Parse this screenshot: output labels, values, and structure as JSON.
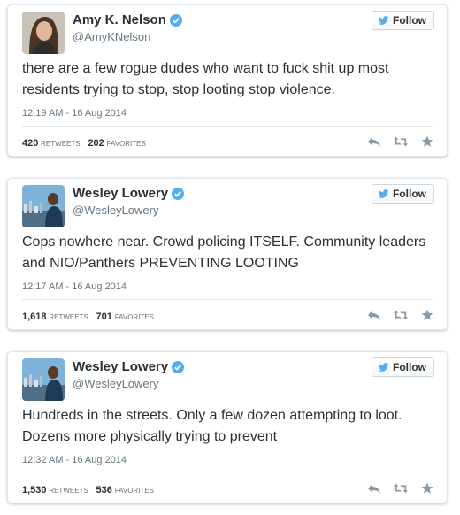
{
  "follow_label": "Follow",
  "colors": {
    "twitter_blue": "#55acee",
    "icon_gray": "#8899a6"
  },
  "tweets": [
    {
      "name": "Amy K. Nelson",
      "handle": "@AmyKNelson",
      "text": "there are a few rogue dudes who want to fuck shit up most residents trying to stop, stop looting stop violence.",
      "time": "12:19 AM - 16 Aug 2014",
      "retweets": "420",
      "retweets_label": "RETWEETS",
      "favorites": "202",
      "favorites_label": "FAVORITES"
    },
    {
      "name": "Wesley Lowery",
      "handle": "@WesleyLowery",
      "text": "Cops nowhere near. Crowd policing ITSELF. Community leaders and NIO/Panthers PREVENTING LOOTING",
      "time": "12:17 AM - 16 Aug 2014",
      "retweets": "1,618",
      "retweets_label": "RETWEETS",
      "favorites": "701",
      "favorites_label": "FAVORITES"
    },
    {
      "name": "Wesley Lowery",
      "handle": "@WesleyLowery",
      "text": "Hundreds in the streets. Only a few dozen attempting to loot. Dozens more physically trying to prevent",
      "time": "12:32 AM - 16 Aug 2014",
      "retweets": "1,530",
      "retweets_label": "RETWEETS",
      "favorites": "536",
      "favorites_label": "FAVORITES"
    }
  ]
}
